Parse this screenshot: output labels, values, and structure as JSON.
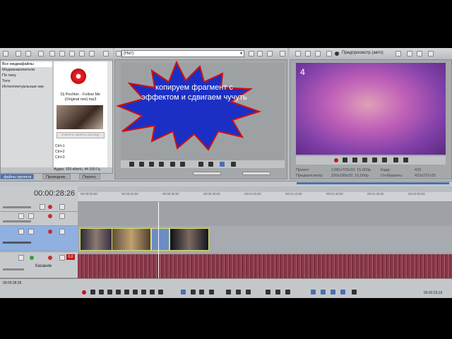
{
  "explorer": {
    "items": [
      {
        "label": "Все медиафайлы"
      },
      {
        "label": "Медианакопители"
      },
      {
        "label": "По типу"
      },
      {
        "label": "Теги"
      },
      {
        "label": "Интеллектуальные нак"
      }
    ],
    "media_title": "Dj Pechkin - Follow Me",
    "media_subtitle": "(Original mix).mp3",
    "extract_button": "Извлечь файлы (выход)",
    "shortcuts": [
      "Ctrl+1",
      "Ctrl+2",
      "Ctrl+3"
    ],
    "audio_info": "Аудио: 320 кбит/с, 44 100 Гц"
  },
  "tabs": {
    "project": "файлы проекта",
    "explorer": "Проводник",
    "transitions": "Перехо"
  },
  "trimmer": {
    "dropdown_value": "(Нет)"
  },
  "preview": {
    "mode_label": "Предпросмотр (авто)",
    "channel_logo": "4",
    "project_label": "Проект:",
    "project_value": "1280x720x32; 15,000р",
    "frame_label": "Кадр:",
    "frame_value": "433",
    "preview_label": "Предпросмотр:",
    "preview_value": "320x180x32; 15,000р",
    "display_label": "Отобразить:",
    "display_value": "422x237x32"
  },
  "timeline": {
    "timecode": "00:00:28:26",
    "ruler": [
      "00:00:00;00",
      "00:00:15;00",
      "00:00:30;00",
      "00:00:45;00",
      "00:01:00;00",
      "00:01:15;00",
      "00:01:30;00",
      "00:01:45;00",
      "00:02:00;00"
    ],
    "audio_track_label": "Касание",
    "audio_level": "0,0",
    "status_time": "00:00:28:26",
    "status_time_right": "00:02:23;15"
  },
  "callout": {
    "text": "копируем фрагмент с эффектом и сдвигаем чучуть",
    "color": "#1c2fc4",
    "border": "#d01010"
  }
}
